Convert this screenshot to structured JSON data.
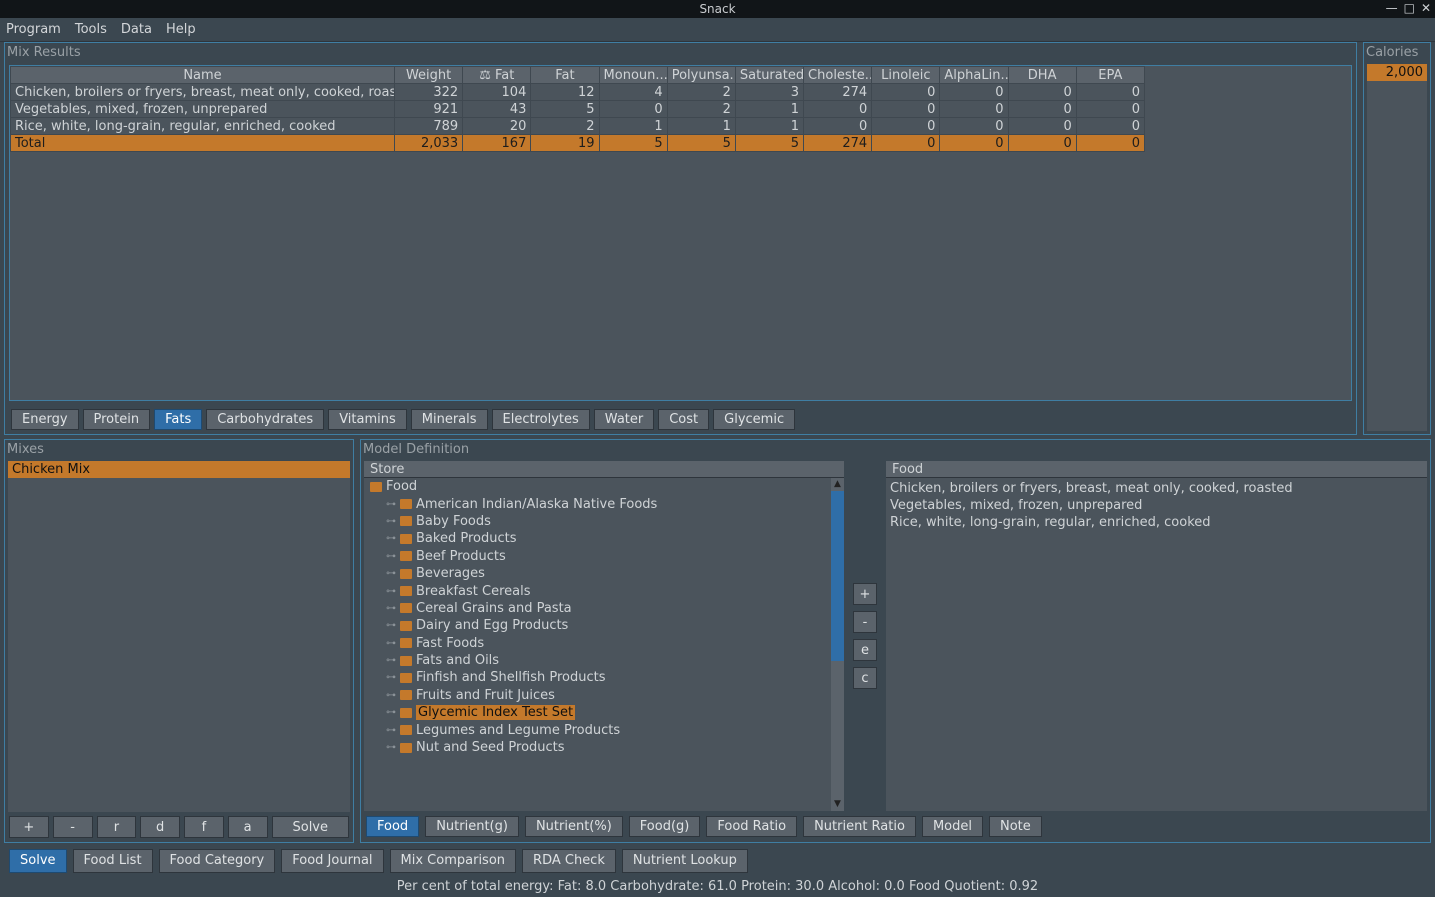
{
  "window": {
    "title": "Snack"
  },
  "menu": {
    "items": [
      "Program",
      "Tools",
      "Data",
      "Help"
    ]
  },
  "mix_results": {
    "title": "Mix Results",
    "columns": [
      "Name",
      "Weight",
      "⚖ Fat",
      "Fat",
      "Monoun...",
      "Polyunsa...",
      "Saturated",
      "Choleste...",
      "Linoleic",
      "AlphaLin...",
      "DHA",
      "EPA"
    ],
    "rows": [
      {
        "name": "Chicken, broilers or fryers, breast, meat only, cooked, roasted",
        "values": [
          "322",
          "104",
          "12",
          "4",
          "2",
          "3",
          "274",
          "0",
          "0",
          "0",
          "0"
        ]
      },
      {
        "name": "Vegetables, mixed, frozen, unprepared",
        "values": [
          "921",
          "43",
          "5",
          "0",
          "2",
          "1",
          "0",
          "0",
          "0",
          "0",
          "0"
        ]
      },
      {
        "name": "Rice, white, long-grain, regular, enriched, cooked",
        "values": [
          "789",
          "20",
          "2",
          "1",
          "1",
          "1",
          "0",
          "0",
          "0",
          "0",
          "0"
        ]
      }
    ],
    "total": {
      "name": "Total",
      "values": [
        "2,033",
        "167",
        "19",
        "5",
        "5",
        "5",
        "274",
        "0",
        "0",
        "0",
        "0"
      ]
    }
  },
  "nutrient_tabs": {
    "items": [
      "Energy",
      "Protein",
      "Fats",
      "Carbohydrates",
      "Vitamins",
      "Minerals",
      "Electrolytes",
      "Water",
      "Cost",
      "Glycemic"
    ],
    "active": "Fats"
  },
  "calories": {
    "label": "Calories",
    "value": "2,000"
  },
  "mixes": {
    "title": "Mixes",
    "items": [
      "Chicken Mix"
    ],
    "selected": "Chicken Mix",
    "buttons": [
      "+",
      "-",
      "r",
      "d",
      "f",
      "a",
      "Solve"
    ]
  },
  "model_def": {
    "title": "Model Definition",
    "store": {
      "title": "Store",
      "root": "Food",
      "children": [
        "American Indian/Alaska Native Foods",
        "Baby Foods",
        "Baked Products",
        "Beef Products",
        "Beverages",
        "Breakfast Cereals",
        "Cereal Grains and Pasta",
        "Dairy and Egg Products",
        "Fast Foods",
        "Fats and Oils",
        "Finfish and Shellfish Products",
        "Fruits and Fruit Juices",
        "Glycemic Index Test Set",
        "Legumes and Legume Products",
        "Nut and Seed Products"
      ],
      "selected": "Glycemic Index Test Set"
    },
    "buttons": [
      "+",
      "-",
      "e",
      "c"
    ],
    "food": {
      "title": "Food",
      "items": [
        "Chicken, broilers or fryers, breast, meat only, cooked, roasted",
        "Vegetables, mixed, frozen, unprepared",
        "Rice, white, long-grain, regular, enriched, cooked"
      ]
    },
    "tabs": {
      "items": [
        "Food",
        "Nutrient(g)",
        "Nutrient(%)",
        "Food(g)",
        "Food Ratio",
        "Nutrient Ratio",
        "Model",
        "Note"
      ],
      "active": "Food"
    }
  },
  "bottom_tabs": {
    "items": [
      "Solve",
      "Food List",
      "Food Category",
      "Food Journal",
      "Mix Comparison",
      "RDA Check",
      "Nutrient Lookup"
    ],
    "active": "Solve"
  },
  "status": {
    "label": "Per cent of total energy:",
    "parts": [
      "Fat: 8.0",
      "Carbohydrate: 61.0",
      "Protein: 30.0",
      "Alcohol: 0.0",
      "Food Quotient: 0.92"
    ]
  }
}
